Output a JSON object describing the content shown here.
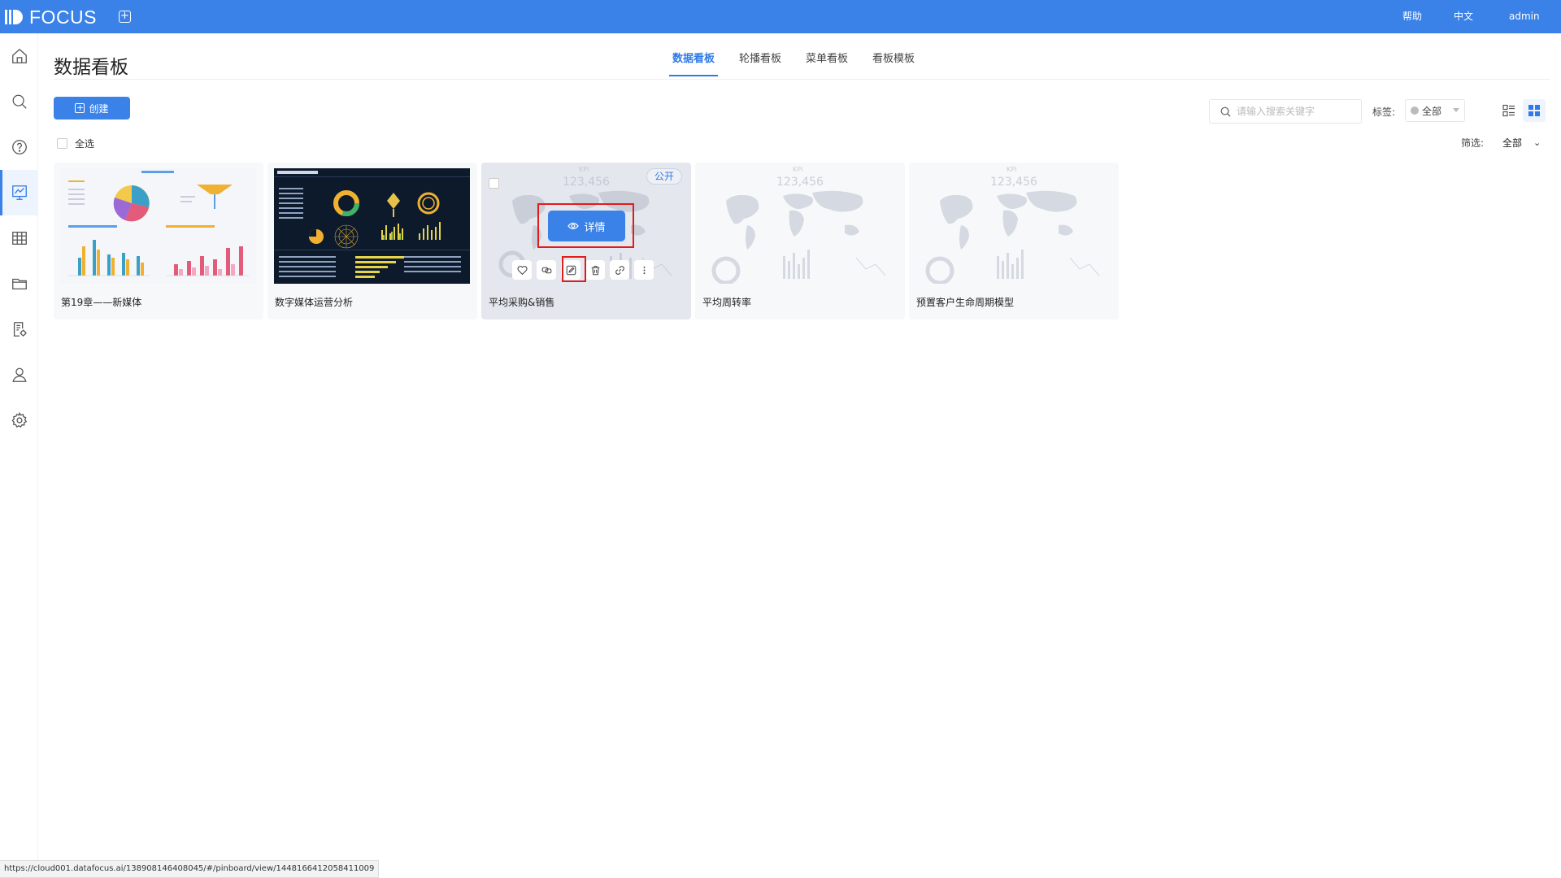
{
  "app": {
    "logo_text": "FOCUS"
  },
  "topbar": {
    "help": "帮助",
    "language": "中文",
    "user": "admin"
  },
  "sidebar": {
    "items": [
      {
        "name": "home",
        "icon": "home-icon"
      },
      {
        "name": "search",
        "icon": "search-icon"
      },
      {
        "name": "question",
        "icon": "question-icon"
      },
      {
        "name": "pinboard",
        "icon": "chart-board-icon",
        "active": true
      },
      {
        "name": "table",
        "icon": "table-icon"
      },
      {
        "name": "folder",
        "icon": "folder-icon"
      },
      {
        "name": "report-settings",
        "icon": "doc-gear-icon"
      },
      {
        "name": "user",
        "icon": "user-icon"
      },
      {
        "name": "settings",
        "icon": "gear-icon"
      }
    ]
  },
  "page": {
    "title": "数据看板"
  },
  "tabs": [
    {
      "label": "数据看板",
      "active": true
    },
    {
      "label": "轮播看板",
      "active": false
    },
    {
      "label": "菜单看板",
      "active": false
    },
    {
      "label": "看板模板",
      "active": false
    }
  ],
  "toolbar": {
    "create_label": "创建",
    "search_placeholder": "请输入搜索关键字",
    "tag_label": "标签:",
    "tag_value": "全部",
    "select_all": "全选",
    "filter_label": "筛选:",
    "filter_value": "全部"
  },
  "cards": [
    {
      "title": "第19章——新媒体"
    },
    {
      "title": "数字媒体运营分析"
    },
    {
      "title": "平均采购&销售",
      "public_tag": "公开",
      "detail_label": "详情",
      "kpi_label": "KPI",
      "kpi_value": "123,456"
    },
    {
      "title": "平均周转率",
      "kpi_label": "KPI",
      "kpi_value": "123,456"
    },
    {
      "title": "预置客户生命周期模型",
      "kpi_label": "KPI",
      "kpi_value": "123,456"
    }
  ],
  "statusbar": {
    "url": "https://cloud001.datafocus.ai/138908146408045/#/pinboard/view/1448166412058411009"
  },
  "colors": {
    "primary": "#3a82e8",
    "highlight": "#e21b1b"
  }
}
